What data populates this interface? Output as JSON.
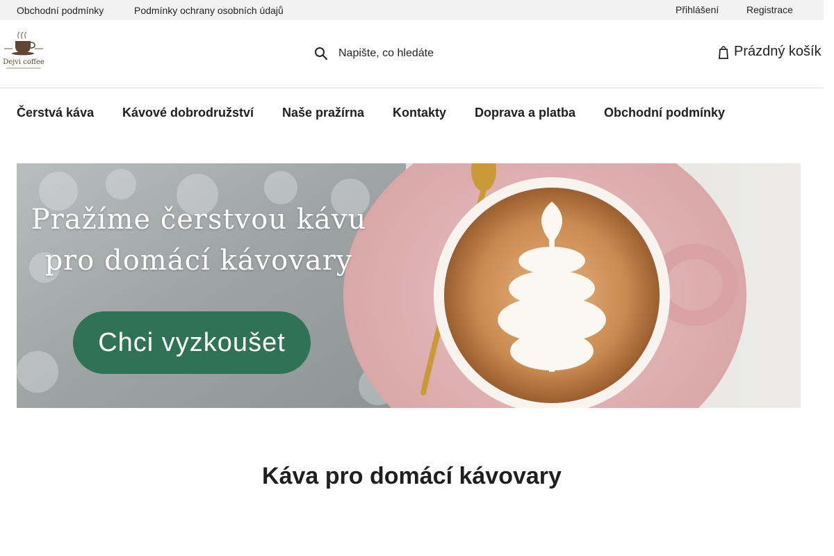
{
  "topbar": {
    "left_links": [
      "Obchodní podmínky",
      "Podmínky ochrany osobních údajů"
    ],
    "right_links": [
      "Přihlášení",
      "Registrace"
    ]
  },
  "header": {
    "logo_text": "Dejvi coffee",
    "search_placeholder": "Napište, co hledáte",
    "cart_label": "Prázdný košík"
  },
  "nav": {
    "items": [
      "Čerstvá káva",
      "Kávové dobrodružství",
      "Naše pražírna",
      "Kontakty",
      "Doprava a platba",
      "Obchodní podmínky"
    ]
  },
  "banner": {
    "headline_line1": "Pražíme čerstvou kávu",
    "headline_line2": "pro domácí kávovary",
    "cta_label": "Chci vyzkoušet",
    "colors": {
      "cta": "#2f7256",
      "saucer": "#e3b6b7",
      "coffee": "#c98a4f"
    }
  },
  "main": {
    "section_title": "Káva pro domácí kávovary"
  }
}
